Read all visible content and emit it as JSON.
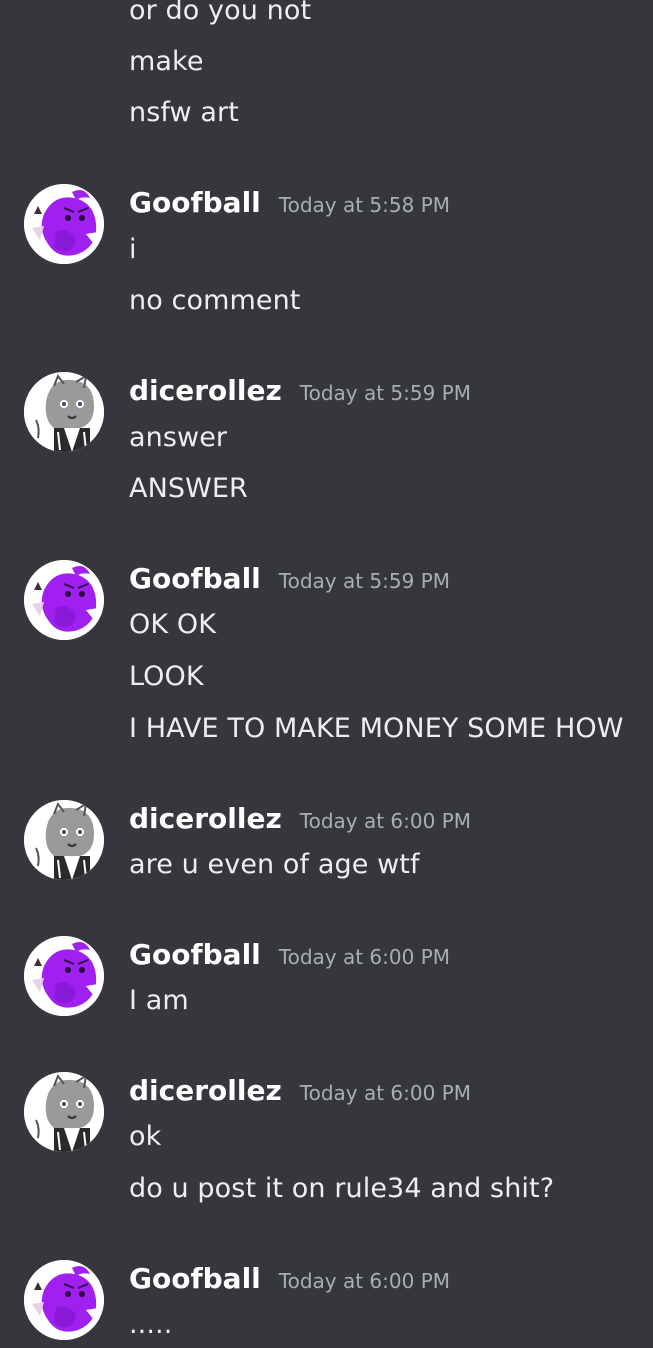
{
  "top_lines": [
    "or do you not",
    "make",
    "nsfw art"
  ],
  "messages": [
    {
      "author": "Goofball",
      "time": "Today at 5:58 PM",
      "lines": [
        "i",
        "no comment"
      ]
    },
    {
      "author": "dicerollez",
      "time": "Today at 5:59 PM",
      "lines": [
        "answer",
        "ANSWER"
      ]
    },
    {
      "author": "Goofball",
      "time": "Today at 5:59 PM",
      "lines": [
        "OK OK",
        "LOOK",
        "I HAVE TO MAKE MONEY SOME HOW"
      ]
    },
    {
      "author": "dicerollez",
      "time": "Today at 6:00 PM",
      "lines": [
        "are u even of age wtf"
      ]
    },
    {
      "author": "Goofball",
      "time": "Today at 6:00 PM",
      "lines": [
        "I am"
      ]
    },
    {
      "author": "dicerollez",
      "time": "Today at 6:00 PM",
      "lines": [
        "ok",
        "do u post it on rule34 and shit?"
      ]
    },
    {
      "author": "Goofball",
      "time": "Today at 6:00 PM",
      "lines": [
        "....."
      ]
    }
  ],
  "colors": {
    "background": "#36373d",
    "username": "#ffffff",
    "message_text": "#eceef1",
    "timestamp": "#a9adb4",
    "goofball_avatar_accent": "#a020f0",
    "dicerollez_avatar_accent": "#8a8a8a"
  },
  "icons": {
    "goofball_avatar": "purple-character-avatar-icon",
    "dicerollez_avatar": "gray-character-avatar-icon"
  }
}
